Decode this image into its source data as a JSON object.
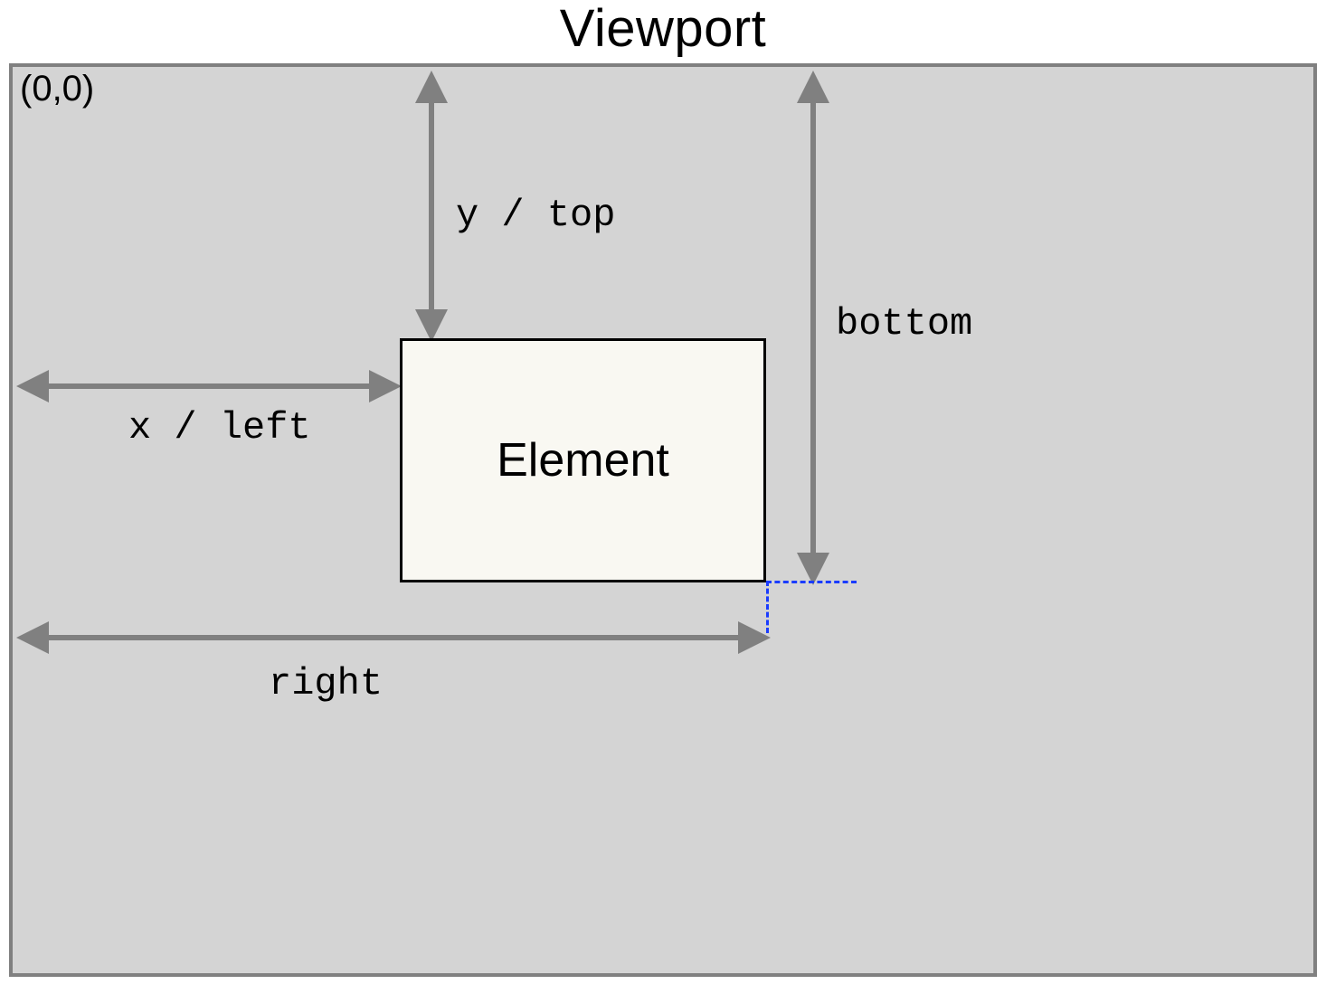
{
  "title": "Viewport",
  "origin_label": "(0,0)",
  "element_label": "Element",
  "labels": {
    "y_top": "y / top",
    "x_left": "x / left",
    "right": "right",
    "bottom": "bottom"
  }
}
